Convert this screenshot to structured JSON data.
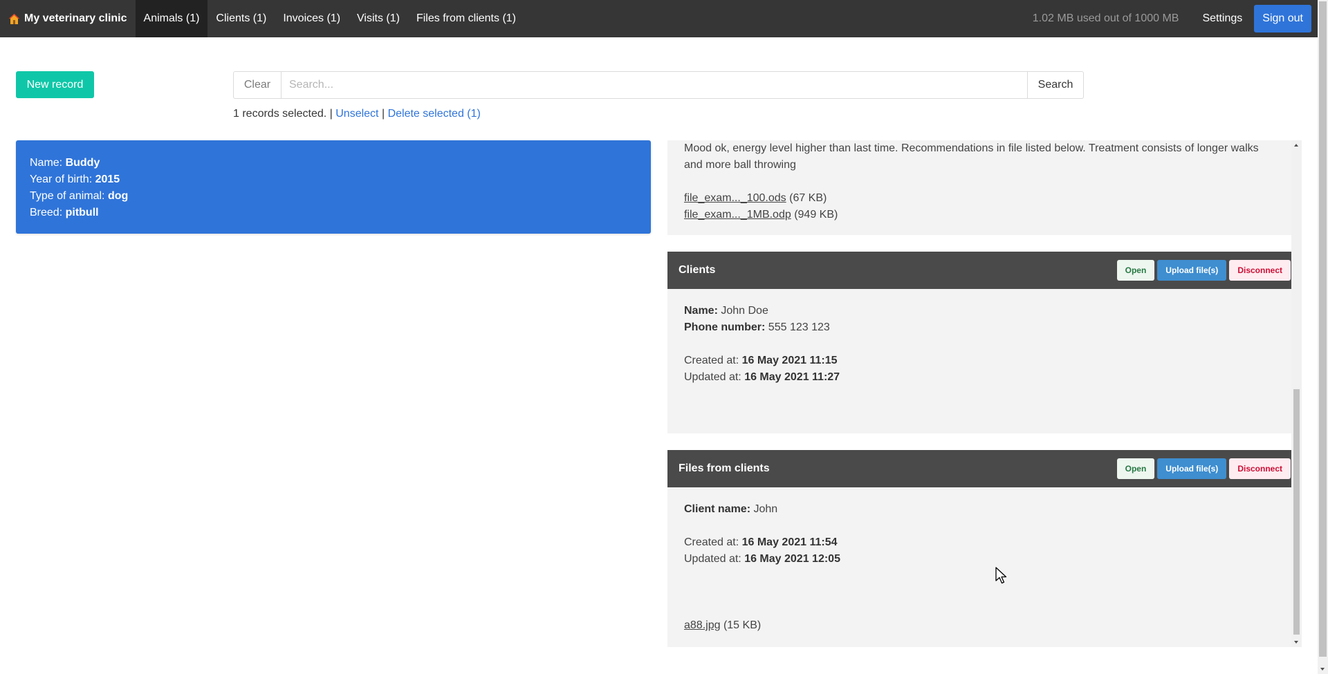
{
  "navbar": {
    "brand": "My veterinary clinic",
    "items": [
      {
        "label": "Animals (1)",
        "active": true
      },
      {
        "label": "Clients (1)"
      },
      {
        "label": "Invoices (1)"
      },
      {
        "label": "Visits (1)"
      },
      {
        "label": "Files from clients (1)"
      }
    ],
    "usage": "1.02 MB used out of 1000 MB",
    "settings": "Settings",
    "sign_out": "Sign out"
  },
  "toolbar": {
    "new_record": "New record",
    "clear": "Clear",
    "search_placeholder": "Search...",
    "search": "Search"
  },
  "selection": {
    "text": "1 records selected.",
    "sep1": "|",
    "unselect": "Unselect",
    "sep2": "|",
    "delete_selected": "Delete selected (1)"
  },
  "animal": {
    "name_label": "Name:",
    "name": "Buddy",
    "year_label": "Year of birth:",
    "year": "2015",
    "type_label": "Type of animal:",
    "type": "dog",
    "breed_label": "Breed:",
    "breed": "pitbull"
  },
  "visit": {
    "notes": "Mood ok, energy level higher than last time. Recommendations in file listed below. Treatment consists of longer walks and more ball throwing",
    "files": [
      {
        "name": "file_exam..._100.ods",
        "size": "(67 KB)"
      },
      {
        "name": "file_exam..._1MB.odp",
        "size": "(949 KB)"
      }
    ]
  },
  "clients": {
    "title": "Clients",
    "open": "Open",
    "upload": "Upload file(s)",
    "disconnect": "Disconnect",
    "name_label": "Name:",
    "name": "John Doe",
    "phone_label": "Phone number:",
    "phone": "555 123 123",
    "created_label": "Created at:",
    "created": "16 May 2021 11:15",
    "updated_label": "Updated at:",
    "updated": "16 May 2021 11:27"
  },
  "files_from_clients": {
    "title": "Files from clients",
    "open": "Open",
    "upload": "Upload file(s)",
    "disconnect": "Disconnect",
    "client_label": "Client name:",
    "client": "John",
    "created_label": "Created at:",
    "created": "16 May 2021 11:54",
    "updated_label": "Updated at:",
    "updated": "16 May 2021 12:05",
    "file": {
      "name": "a88.jpg",
      "size": "(15 KB)"
    }
  }
}
